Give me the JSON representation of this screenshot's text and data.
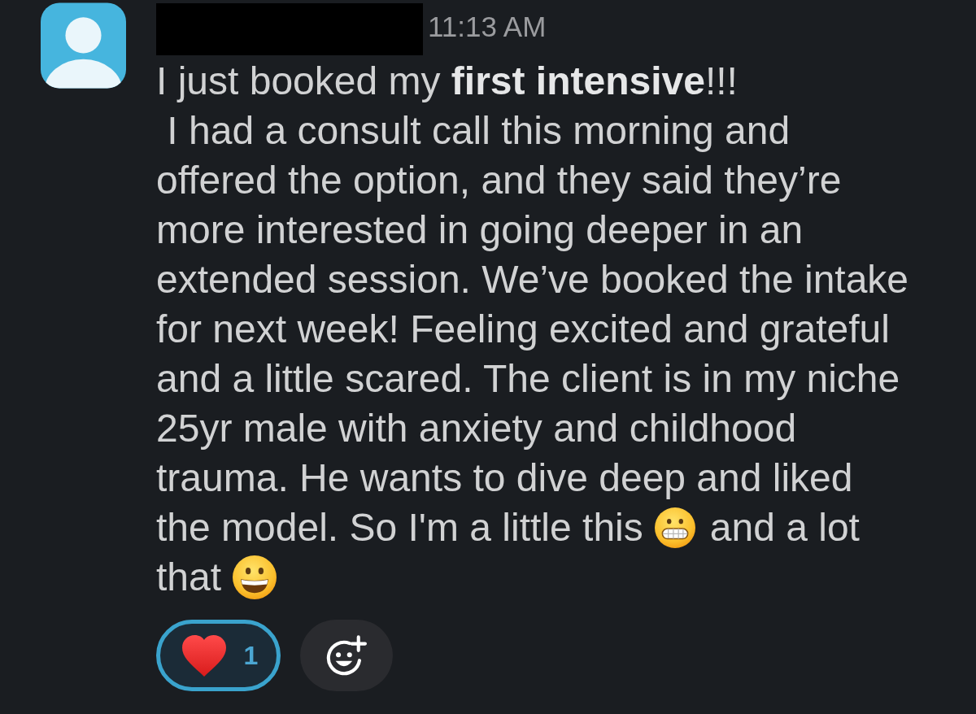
{
  "message": {
    "time": "11:13 AM",
    "lines": [
      [
        {
          "kind": "text",
          "text": "I just booked my **first intensive**!!!"
        }
      ],
      [
        {
          "kind": "text",
          "text": " I had a consult call this morning and"
        }
      ],
      [
        {
          "kind": "text",
          "text": "offered the option, and they said they’re"
        }
      ],
      [
        {
          "kind": "text",
          "text": "more interested in going deeper in an"
        }
      ],
      [
        {
          "kind": "text",
          "text": "extended session. We’ve booked the intake"
        }
      ],
      [
        {
          "kind": "text",
          "text": "for next week! Feeling excited and grateful"
        }
      ],
      [
        {
          "kind": "text",
          "text": "and a little scared. The client is in my niche"
        }
      ],
      [
        {
          "kind": "text",
          "text": "25yr male with anxiety and childhood"
        }
      ],
      [
        {
          "kind": "text",
          "text": "trauma. He wants to dive deep and liked"
        }
      ],
      [
        {
          "kind": "text",
          "text": "the model. So I'm a little this"
        },
        {
          "kind": "grimacing"
        },
        {
          "kind": "text",
          "text": "and a lot"
        }
      ],
      [
        {
          "kind": "text",
          "text": "that"
        },
        {
          "kind": "grinning"
        }
      ]
    ]
  },
  "reactions": [
    {
      "kind": "heart",
      "count": "1",
      "selected": true
    }
  ]
}
